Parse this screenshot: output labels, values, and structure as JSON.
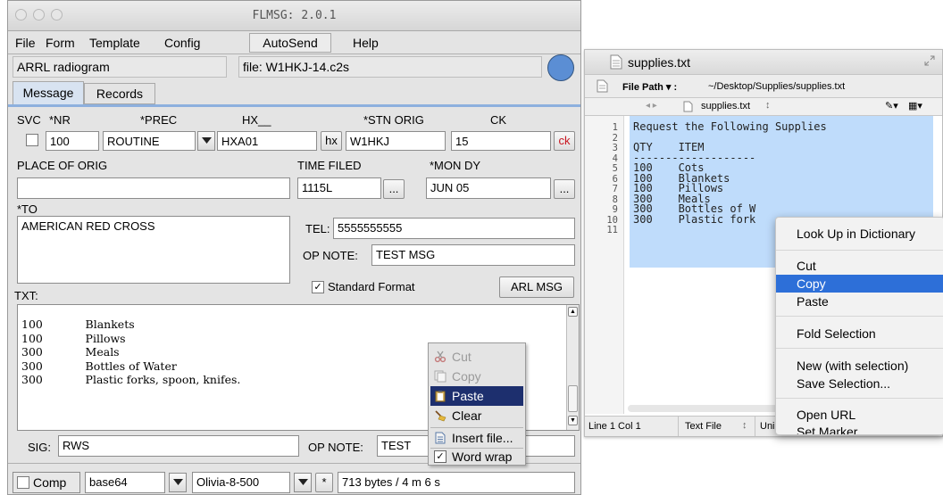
{
  "flmsg": {
    "window_title": "FLMSG: 2.0.1",
    "menu": {
      "file": "File",
      "form": "Form",
      "template": "Template",
      "config": "Config",
      "autosend": "AutoSend",
      "help": "Help"
    },
    "form_name": "ARRL radiogram",
    "file_label": "file: W1HKJ-14.c2s",
    "tabs": {
      "message": "Message",
      "records": "Records"
    },
    "labels": {
      "svc": "SVC",
      "nr": "*NR",
      "prec": "*PREC",
      "hx": "HX__",
      "stn_orig": "*STN ORIG",
      "ck": "CK",
      "place_of_orig": "PLACE OF ORIG",
      "time_filed": "TIME FILED",
      "mon_dy": "*MON DY",
      "to": "*TO",
      "tel": "TEL:",
      "op_note": "OP NOTE:",
      "txt": "TXT:",
      "sig": "SIG:",
      "op_note2": "OP NOTE:"
    },
    "values": {
      "nr": "100",
      "prec": "ROUTINE",
      "hx": "HXA01",
      "stn_orig": "W1HKJ",
      "ck": "15",
      "place_of_orig": "",
      "time_filed": "1115L",
      "mon_dy": "JUN 05",
      "to": "AMERICAN RED CROSS",
      "tel": "5555555555",
      "op_note": "TEST MSG",
      "sig": "RWS",
      "op_note2": "TEST"
    },
    "buttons": {
      "hx": "hx",
      "ck": "ck",
      "time_ellipsis": "...",
      "date_ellipsis": "...",
      "arl_msg": "ARL MSG",
      "standard_format": "Standard Format"
    },
    "txt_body": "100            Blankets\n100            Pillows\n300            Meals\n300            Bottles of Water\n300            Plastic forks, spoon, knifes.",
    "bottom": {
      "comp": "Comp",
      "encoding": "base64",
      "mode": "Olivia-8-500",
      "asterisk": "*",
      "status": "713 bytes / 4 m 6 s"
    },
    "context_menu": {
      "cut": "Cut",
      "copy": "Copy",
      "paste": "Paste",
      "clear": "Clear",
      "insert_file": "Insert file...",
      "word_wrap": "Word wrap"
    }
  },
  "editor": {
    "window_title": "supplies.txt",
    "path_label": "File Path ▾ :",
    "path_value": "~/Desktop/Supplies/supplies.txt",
    "tab_name": "supplies.txt",
    "tab_arrows": "◂  ▸",
    "tab_stepper": "↕",
    "line_numbers": "1\n2\n3\n4\n5\n6\n7\n8\n9\n10\n11",
    "text": "Request the Following Supplies\n\nQTY    ITEM\n-------------------\n100    Cots\n100    Blankets\n100    Pillows\n300    Meals\n300    Bottles of W\n300    Plastic fork",
    "status": {
      "position": "Line 1 Col 1",
      "file_type": "Text File",
      "stepper": "↕",
      "encoding": "Uni"
    },
    "context_menu": {
      "look_up": "Look Up in Dictionary",
      "cut": "Cut",
      "copy": "Copy",
      "paste": "Paste",
      "fold_selection": "Fold Selection",
      "new_with_selection": "New (with selection)",
      "save_selection": "Save Selection...",
      "open_url": "Open URL",
      "set_marker": "Set Marker"
    }
  },
  "colors": {
    "flmsg_bg": "#e4e4e4",
    "tab_selected": "#d8e3f1",
    "ck_red": "#c8141e",
    "status_circle": "#5b8ed4",
    "fl_menu_selected": "#1d2f6e",
    "editor_selection": "#bfdcfb",
    "mac_menu_selected": "#2d6fd8"
  }
}
